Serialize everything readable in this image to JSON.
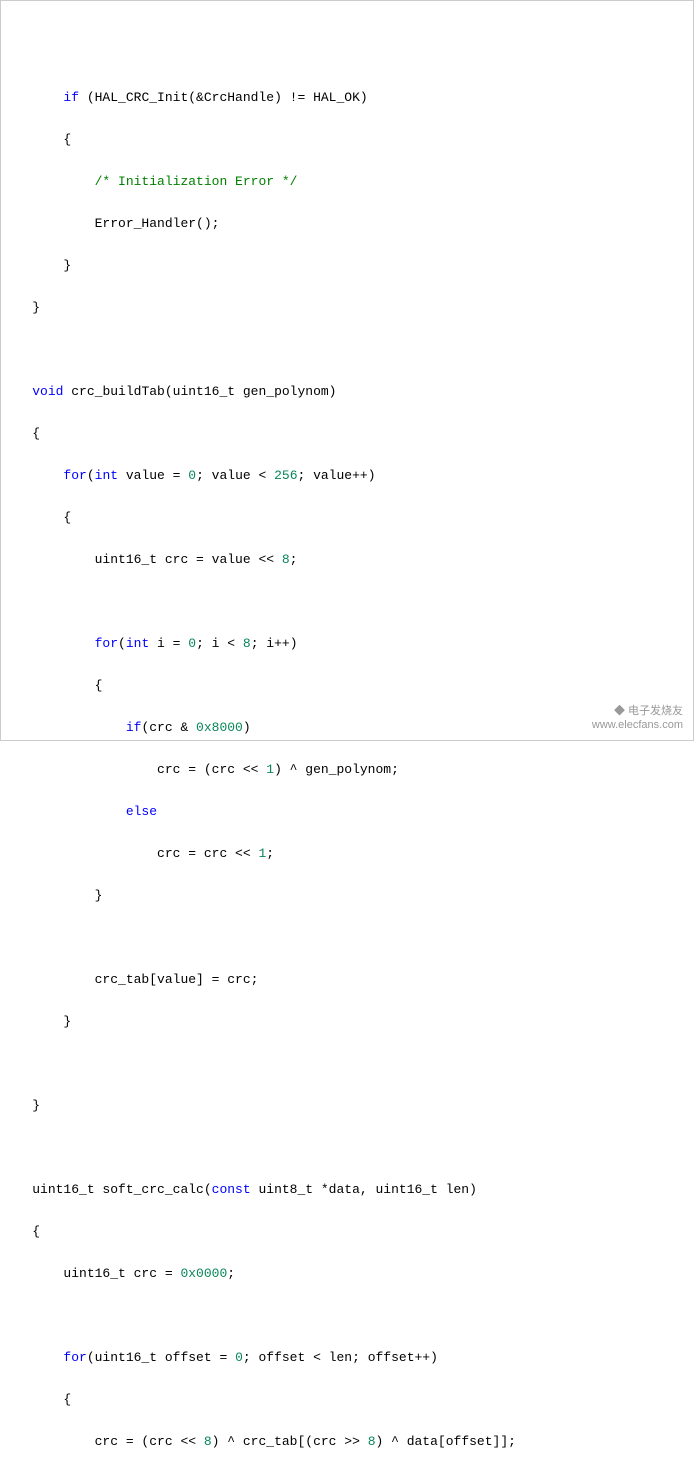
{
  "code": {
    "l1_kw_if": "if",
    "l1_text": " (HAL_CRC_Init(&CrcHandle) != HAL_OK)",
    "l2": "{",
    "l3_comment": "/* Initialization Error */",
    "l4": "Error_Handler();",
    "l5": "}",
    "l6": "}",
    "l8_kw_void": "void",
    "l8_text": " crc_buildTab(uint16_t gen_polynom)",
    "l9": "{",
    "l10_kw_for": "for",
    "l10_text1": "(",
    "l10_kw_int": "int",
    "l10_text2": " value = ",
    "l10_num0": "0",
    "l10_text3": "; value < ",
    "l10_num256": "256",
    "l10_text4": "; value++)",
    "l11": "{",
    "l12_text1": "uint16_t crc = value << ",
    "l12_num8": "8",
    "l12_text2": ";",
    "l14_kw_for": "for",
    "l14_text1": "(",
    "l14_kw_int": "int",
    "l14_text2": " i = ",
    "l14_num0": "0",
    "l14_text3": "; i < ",
    "l14_num8": "8",
    "l14_text4": "; i++)",
    "l15": "{",
    "l16_kw_if": "if",
    "l16_text1": "(crc & ",
    "l16_hex": "0x8000",
    "l16_text2": ")",
    "l17_text1": "crc = (crc << ",
    "l17_num1": "1",
    "l17_text2": ") ^ gen_polynom;",
    "l18_kw_else": "else",
    "l19_text1": "crc = crc << ",
    "l19_num1": "1",
    "l19_text2": ";",
    "l20": "}",
    "l22": "crc_tab[value] = crc;",
    "l23": "}",
    "l25": "}",
    "l27_text1": "uint16_t soft_crc_calc(",
    "l27_kw_const": "const",
    "l27_text2": " uint8_t *data, uint16_t len)",
    "l28": "{",
    "l29_text1": "uint16_t crc = ",
    "l29_hex": "0x0000",
    "l29_text2": ";",
    "l31_kw_for": "for",
    "l31_text1": "(uint16_t offset = ",
    "l31_num0": "0",
    "l31_text2": "; offset < len; offset++)",
    "l32": "{",
    "l33_text1": "crc = (crc << ",
    "l33_num8a": "8",
    "l33_text2": ") ^ crc_tab[(crc >> ",
    "l33_num8b": "8",
    "l33_text3": ") ^ data[offset]];"
  },
  "indent": {
    "i2": "        ",
    "i3": "            ",
    "i1": "    ",
    "i4": "                ",
    "i5": "                    ",
    "i0": ""
  },
  "watermark": {
    "line1": "电子发烧友",
    "line2": "www.elecfans.com"
  }
}
